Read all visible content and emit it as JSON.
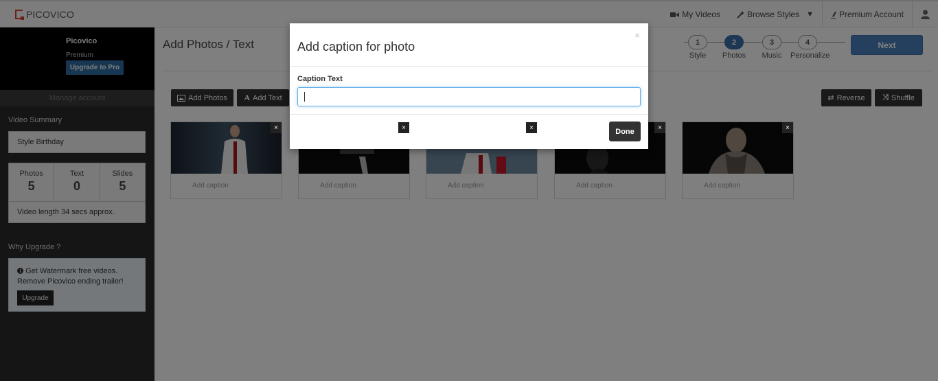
{
  "brand": {
    "name": "PICOVICO"
  },
  "nav": {
    "my_videos": "My Videos",
    "browse_styles": "Browse Styles",
    "premium_account": "Premium Account"
  },
  "sidebar": {
    "profile_name": "Picovico",
    "plan": "Premium",
    "upgrade_pro": "Upgrade to Pro",
    "manage_account": "Manage account",
    "video_summary_heading": "Video Summary",
    "style": "Style Birthday",
    "stats": [
      {
        "label": "Photos",
        "value": "5"
      },
      {
        "label": "Text",
        "value": "0"
      },
      {
        "label": "Slides",
        "value": "5"
      }
    ],
    "video_length": "Video length 34 secs approx.",
    "why_upgrade_heading": "Why Upgrade ?",
    "why_upgrade_text": "Get Watermark free videos. Remove Picovico ending trailer!",
    "upgrade_button": "Upgrade"
  },
  "main": {
    "title": "Add Photos / Text",
    "steps": [
      {
        "number": "1",
        "label": "Style",
        "active": false
      },
      {
        "number": "2",
        "label": "Photos",
        "active": true
      },
      {
        "number": "3",
        "label": "Music",
        "active": false
      },
      {
        "number": "4",
        "label": "Personalize",
        "active": false
      }
    ],
    "next_button": "Next",
    "add_photos": "Add Photos",
    "add_text": "Add Text",
    "reverse": "Reverse",
    "shuffle": "Shuffle",
    "card_caption_placeholder": "Add caption",
    "card_close": "×"
  },
  "modal": {
    "title": "Add caption for photo",
    "close": "×",
    "caption_label": "Caption Text",
    "caption_value": "",
    "done_button": "Done"
  },
  "colors": {
    "accent": "#4a80bf",
    "brand_red": "#d9432d",
    "sidebar_bg": "#2b2b2b",
    "overlay": "rgba(0,0,0,0.5)"
  }
}
